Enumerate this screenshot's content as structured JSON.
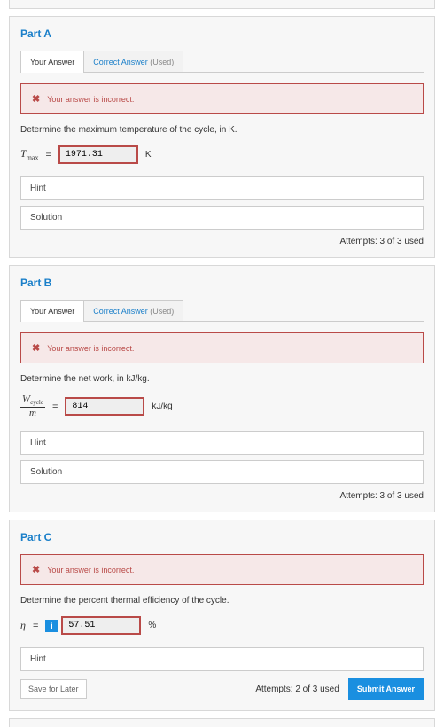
{
  "common": {
    "tab_your_answer": "Your Answer",
    "tab_correct_answer": "Correct Answer",
    "tab_used": " (Used)",
    "error_msg": "Your answer is incorrect.",
    "hint_label": "Hint",
    "solution_label": "Solution",
    "save_label": "Save for Later",
    "submit_label": "Submit Answer"
  },
  "partA": {
    "title": "Part A",
    "prompt": "Determine the maximum temperature of the cycle, in K.",
    "var_main": "T",
    "var_sub": "max",
    "eq": " = ",
    "value": "1971.31",
    "unit": "K",
    "attempts": "Attempts: 3 of 3 used"
  },
  "partB": {
    "title": "Part B",
    "prompt": "Determine the net work, in kJ/kg.",
    "frac_top_main": "W",
    "frac_top_sub": "cycle",
    "frac_bot": "m",
    "eq": " = ",
    "value": "814",
    "unit": "kJ/kg",
    "attempts": "Attempts: 3 of 3 used"
  },
  "partC": {
    "title": "Part C",
    "prompt": "Determine the percent thermal efficiency of the cycle.",
    "var_main": "η",
    "eq": " = ",
    "info": "i",
    "value": "57.51",
    "unit": "%",
    "attempts": "Attempts: 2 of 3 used"
  }
}
